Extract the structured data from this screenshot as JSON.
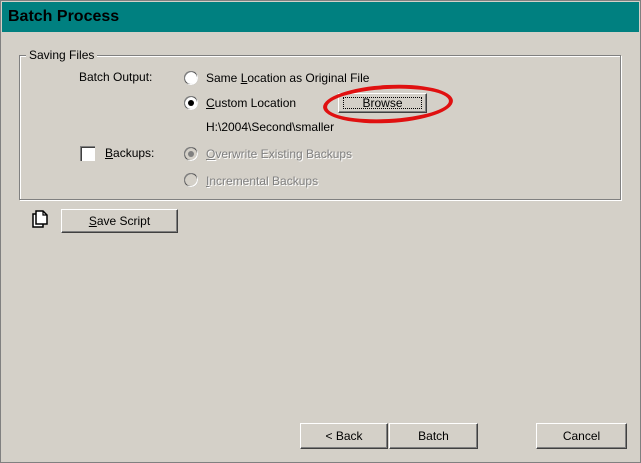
{
  "window": {
    "title": "Batch Process"
  },
  "saving_files": {
    "legend": "Saving Files",
    "batch_output_label": "Batch Output:",
    "options": {
      "same_location": {
        "prefix": "Same ",
        "mnemonic": "L",
        "suffix": "ocation as Original File",
        "selected": false
      },
      "custom_location": {
        "prefix": "",
        "mnemonic": "C",
        "suffix": "ustom Location",
        "selected": true
      }
    },
    "browse_button": "Browse",
    "custom_path": "H:\\2004\\Second\\smaller",
    "backups": {
      "label_mnemonic": "B",
      "label_rest": "ackups:",
      "checked": false,
      "overwrite": {
        "mnemonic": "O",
        "suffix": "verwrite Existing Backups",
        "selected": true,
        "enabled": false
      },
      "incremental": {
        "mnemonic": "I",
        "suffix": "ncremental Backups",
        "selected": false,
        "enabled": false
      }
    }
  },
  "script": {
    "icon": "copy-document-icon",
    "save_button_mnemonic": "S",
    "save_button_rest": "ave Script"
  },
  "footer": {
    "back_button": "< Back",
    "batch_button": "Batch",
    "cancel_button": "Cancel"
  },
  "annotation": {
    "color": "#e01010"
  }
}
